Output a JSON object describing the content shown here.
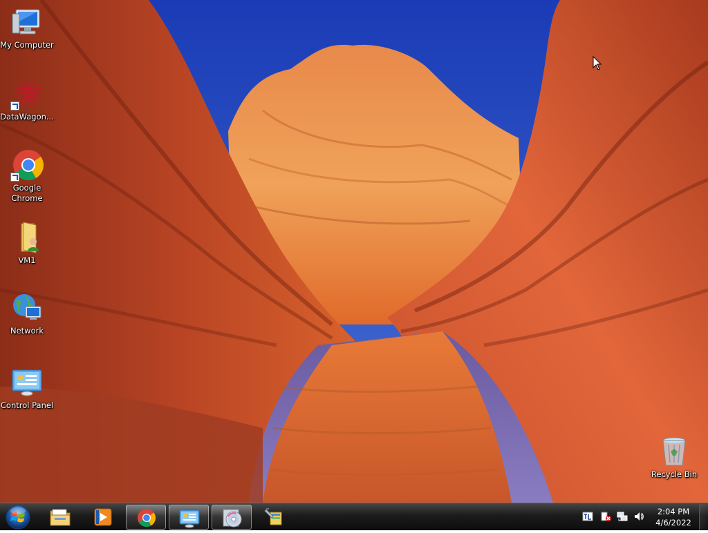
{
  "desktop": {
    "icons": [
      {
        "label": "My Computer"
      },
      {
        "label": "DataWagon..."
      },
      {
        "label": "Google Chrome"
      },
      {
        "label": "VM1"
      },
      {
        "label": "Network"
      },
      {
        "label": "Control Panel"
      },
      {
        "label": "Recycle Bin"
      }
    ]
  },
  "taskbar": {
    "pinned": [
      {
        "icon": "file-explorer-icon"
      },
      {
        "icon": "media-player-icon"
      },
      {
        "icon": "chrome-icon",
        "active": true
      },
      {
        "icon": "control-panel-icon"
      },
      {
        "icon": "disc-burner-icon"
      },
      {
        "icon": "setup-tool-icon"
      }
    ],
    "tray": {
      "icons": [
        "language-bar-icon",
        "action-center-icon",
        "network-icon",
        "volume-icon"
      ],
      "time": "2:04 PM",
      "date": "4/6/2022"
    }
  },
  "colors": {
    "sky": "#2a4fc0",
    "rock_orange": "#e8601f",
    "rock_dark": "#8a2a14",
    "taskbar": "#141414"
  }
}
